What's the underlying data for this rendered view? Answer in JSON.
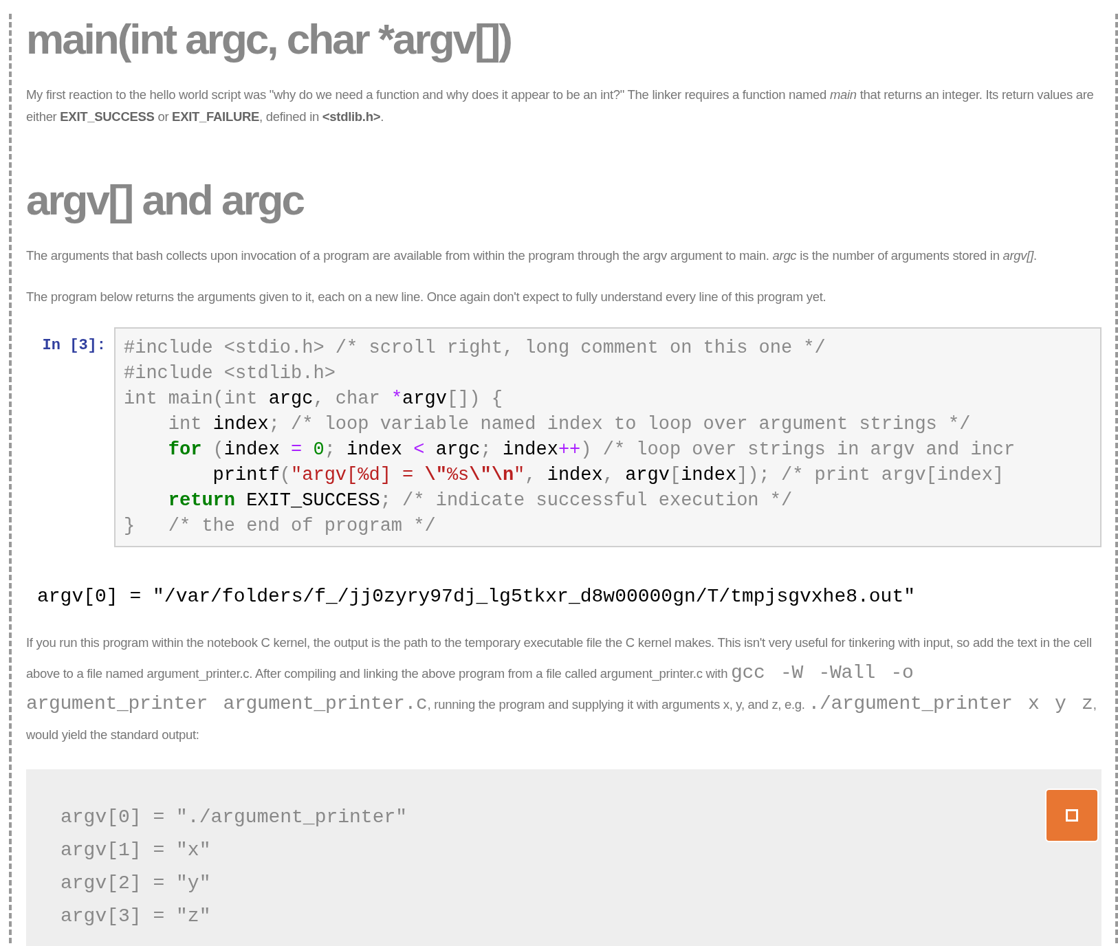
{
  "sections": [
    {
      "heading": "main(int argc, char *argv[])",
      "paragraphs": [
        [
          {
            "kind": "text",
            "text": "My first reaction to the hello world script was \"why do we need a function and why does it appear to be an int?\" The linker requires a function named *main* that returns an integer. Its return values are either **EXIT_SUCCESS** or **EXIT_FAILURE**, defined in **<stdlib.h>**."
          }
        ]
      ]
    },
    {
      "heading": "argv[] and argc",
      "paragraphs": [
        [
          {
            "kind": "text",
            "text": "The arguments that bash collects upon invocation of a program are available from within the program through the argv argument to main. *argc* is the number of arguments stored in *argv[]*."
          }
        ],
        [
          {
            "kind": "text",
            "text": "The program below returns the arguments given to it, each on a new line. Once again don't expect to fully understand every line of this program yet."
          }
        ]
      ]
    }
  ],
  "code_cell": {
    "prompt": "In [3]:",
    "lines": [
      [
        {
          "kind": "comment",
          "text": "#include <stdio.h> /* scroll right, long comment on this one */"
        }
      ],
      [
        {
          "kind": "comment",
          "text": "#include <stdlib.h>"
        }
      ],
      [
        {
          "kind": "type",
          "text": "int main(int "
        },
        {
          "kind": "name",
          "text": "argc"
        },
        {
          "kind": "type",
          "text": ", char "
        },
        {
          "kind": "op",
          "text": "*"
        },
        {
          "kind": "name",
          "text": "argv"
        },
        {
          "kind": "type",
          "text": "[]) {"
        }
      ],
      [
        {
          "kind": "type",
          "text": "    int "
        },
        {
          "kind": "name",
          "text": "index"
        },
        {
          "kind": "type",
          "text": "; "
        },
        {
          "kind": "comment",
          "text": "/* loop variable named index to loop over argument strings */"
        }
      ],
      [
        {
          "kind": "kw",
          "text": "    for"
        },
        {
          "kind": "type",
          "text": " ("
        },
        {
          "kind": "name",
          "text": "index"
        },
        {
          "kind": "op",
          "text": " = "
        },
        {
          "kind": "num",
          "text": "0"
        },
        {
          "kind": "type",
          "text": "; "
        },
        {
          "kind": "name",
          "text": "index"
        },
        {
          "kind": "op",
          "text": " < "
        },
        {
          "kind": "name",
          "text": "argc"
        },
        {
          "kind": "type",
          "text": "; "
        },
        {
          "kind": "name",
          "text": "index"
        },
        {
          "kind": "op",
          "text": "++"
        },
        {
          "kind": "type",
          "text": ") "
        },
        {
          "kind": "comment",
          "text": "/* loop over strings in argv and incr"
        }
      ],
      [
        {
          "kind": "name",
          "text": "        printf"
        },
        {
          "kind": "type",
          "text": "("
        },
        {
          "kind": "str",
          "text": "\"argv[%d] = "
        },
        {
          "kind": "esc",
          "text": "\\\""
        },
        {
          "kind": "str",
          "text": "%s"
        },
        {
          "kind": "esc",
          "text": "\\\"\\n"
        },
        {
          "kind": "str",
          "text": "\""
        },
        {
          "kind": "type",
          "text": ", "
        },
        {
          "kind": "name",
          "text": "index"
        },
        {
          "kind": "type",
          "text": ", "
        },
        {
          "kind": "name",
          "text": "argv"
        },
        {
          "kind": "type",
          "text": "["
        },
        {
          "kind": "name",
          "text": "index"
        },
        {
          "kind": "type",
          "text": "]); "
        },
        {
          "kind": "comment",
          "text": "/* print argv[index]"
        }
      ],
      [
        {
          "kind": "kw",
          "text": "    return"
        },
        {
          "kind": "name",
          "text": " EXIT_SUCCESS"
        },
        {
          "kind": "type",
          "text": "; "
        },
        {
          "kind": "comment",
          "text": "/* indicate successful execution */"
        }
      ],
      [
        {
          "kind": "type",
          "text": "}   "
        },
        {
          "kind": "comment",
          "text": "/* the end of program */"
        }
      ]
    ]
  },
  "output": "argv[0] = \"/var/folders/f_/jj0zyry97dj_lg5tkxr_d8w00000gn/T/tmpjsgvxhe8.out\"",
  "explanation": [
    {
      "kind": "text",
      "text": "If you run this program within the notebook C kernel, the output is the path to the temporary executable file the C kernel makes. This isn't very useful for tinkering with input, so add the text in the cell above to a file named argument_printer.c. After compiling and linking the above program from a file called argument_printer.c with "
    },
    {
      "kind": "code",
      "text": "gcc -W -Wall -o argument_printer argument_printer.c"
    },
    {
      "kind": "text",
      "text": ", running the program and supplying it with arguments x, y, and z, e.g. "
    },
    {
      "kind": "code",
      "text": "./argument_printer x y z"
    },
    {
      "kind": "text",
      "text": ", would yield the standard output:"
    }
  ],
  "standard_output": {
    "lines": [
      "argv[0] = \"./argument_printer\"",
      "argv[1] = \"x\"",
      "argv[2] = \"y\"",
      "argv[3] = \"z\""
    ]
  }
}
